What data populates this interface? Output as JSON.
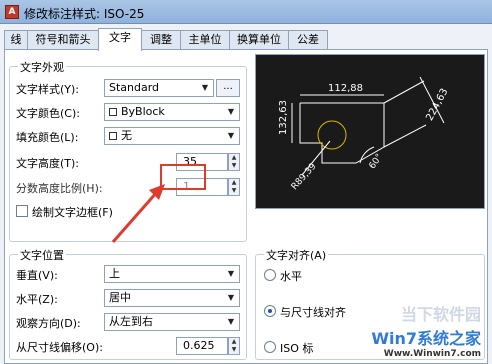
{
  "title": "修改标注样式: ISO-25",
  "tabs": [
    "线",
    "符号和箭头",
    "文字",
    "调整",
    "主单位",
    "换算单位",
    "公差"
  ],
  "appearance": {
    "title": "文字外观",
    "style_label": "文字样式(Y):",
    "style_value": "Standard",
    "style_btn": "...",
    "color_label": "文字颜色(C):",
    "color_value": "ByBlock",
    "fill_label": "填充颜色(L):",
    "fill_value": "无",
    "height_label": "文字高度(T):",
    "height_value": "35",
    "scale_label": "分数高度比例(H):",
    "scale_value": "1",
    "frame_label": "绘制文字边框(F)"
  },
  "placement": {
    "title": "文字位置",
    "vertical_label": "垂直(V):",
    "vertical_value": "上",
    "horizontal_label": "水平(Z):",
    "horizontal_value": "居中",
    "direction_label": "观察方向(D):",
    "direction_value": "从左到右",
    "offset_label": "从尺寸线偏移(O):",
    "offset_value": "0.625"
  },
  "alignment": {
    "title": "文字对齐(A)",
    "options": [
      "水平",
      "与尺寸线对齐",
      "ISO 标"
    ]
  },
  "preview": {
    "dim_top": "112,88",
    "dim_left": "132,63",
    "dim_right": "224,63",
    "dim_angle": "60°",
    "dim_radius": "R89,39"
  },
  "watermark": {
    "line1": "当下软件园",
    "line2": "Win7系统之家",
    "line3": "Www.Winwin7.com"
  },
  "colors": {
    "highlight": "#e03a2a",
    "preview_bg": "#1a1a1a",
    "preview_line": "#ffffff",
    "preview_circle": "#d4b800"
  }
}
